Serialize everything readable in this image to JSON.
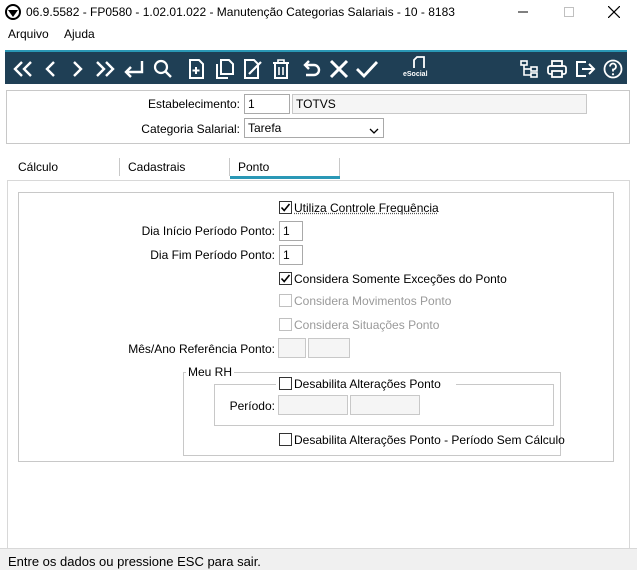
{
  "window": {
    "title": "06.9.5582 - FP0580 - 1.02.01.022 - Manutenção Categorias Salariais - 10 - 8183"
  },
  "menu": {
    "items": [
      "Arquivo",
      "Ajuda"
    ]
  },
  "toolbar": {
    "icons": [
      "first-icon",
      "previous-icon",
      "next-icon",
      "last-icon",
      "goto-icon",
      "search-icon",
      "new-icon",
      "copy-icon",
      "edit-icon",
      "delete-icon",
      "undo-icon",
      "cancel-icon",
      "confirm-icon",
      "esocial-icon",
      "tree-icon",
      "print-icon",
      "exit-icon",
      "help-icon"
    ],
    "esocial_label": "eSocial",
    "colors": {
      "background": "#1f3f55",
      "accent": "#2a98b6",
      "icon": "#ffffff"
    }
  },
  "header": {
    "estabelecimento_label": "Estabelecimento:",
    "estabelecimento_value": "1",
    "estabelecimento_name": "TOTVS",
    "categoria_label": "Categoria Salarial:",
    "categoria_value": "Tarefa"
  },
  "tabs": {
    "items": [
      "Cálculo",
      "Cadastrais",
      "Ponto"
    ],
    "active": "Ponto"
  },
  "ponto": {
    "utiliza_controle": {
      "label": "Utiliza Controle Frequência",
      "checked": true
    },
    "dia_inicio_label": "Dia Início Período Ponto:",
    "dia_inicio_value": "1",
    "dia_fim_label": "Dia Fim Período Ponto:",
    "dia_fim_value": "1",
    "somente_excecoes": {
      "label": "Considera Somente Exceções do Ponto",
      "checked": true
    },
    "movimentos": {
      "label": "Considera Movimentos Ponto",
      "checked": false,
      "disabled": true
    },
    "situacoes": {
      "label": "Considera Situações Ponto",
      "checked": false,
      "disabled": true
    },
    "mes_ano_label": "Mês/Ano Referência Ponto:",
    "mes_value": "",
    "ano_value": "",
    "meu_rh": {
      "title": "Meu RH",
      "desabilita_alteracoes": {
        "label": "Desabilita Alterações Ponto",
        "checked": false
      },
      "periodo_label": "Período:",
      "periodo_inicio": "",
      "periodo_fim": "",
      "desabilita_sem_calculo": {
        "label": "Desabilita Alterações Ponto - Período Sem Cálculo",
        "checked": false
      }
    }
  },
  "status": {
    "text": "Entre os dados ou pressione ESC para sair."
  }
}
